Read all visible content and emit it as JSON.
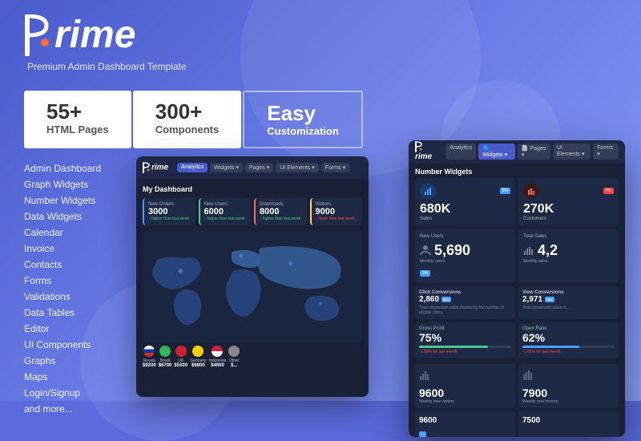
{
  "brand": {
    "name": "Prime",
    "p_letter": "P",
    "rest": "rime",
    "subtitle": "Premium Admin Dashboard Template"
  },
  "stats": [
    {
      "number": "55+",
      "label": "HTML Pages"
    },
    {
      "number": "300+",
      "label": "Components"
    },
    {
      "number": "Easy",
      "label": "Customization"
    }
  ],
  "nav": {
    "items": [
      "Admin Dashboard",
      "Graph Widgets",
      "Number Widgets",
      "Data Widgets",
      "Calendar",
      "Invoice",
      "Contacts",
      "Forms",
      "Validations",
      "Data Tables",
      "Editor",
      "UI Components",
      "Graphs",
      "Maps",
      "Login/Signup",
      "and more..."
    ]
  },
  "dashboard_left": {
    "title": "My Dashboard",
    "topnav": [
      "Analytics",
      "Widgets",
      "Pages",
      "UI Elements",
      "Forms"
    ],
    "stats": [
      {
        "label": "New Orders",
        "value": "3000",
        "sub": "higher than last week"
      },
      {
        "label": "New Users",
        "value": "6000",
        "sub": "higher than last week"
      },
      {
        "label": "Downloads",
        "value": "8000",
        "sub": "higher than last week"
      },
      {
        "label": "Visitors",
        "value": "9000",
        "sub": "lower than last week"
      }
    ],
    "flags": [
      {
        "country": "Russia",
        "value": "$9200",
        "color": "#4a9eff"
      },
      {
        "country": "Brazil",
        "value": "$6700",
        "color": "#2db85a"
      },
      {
        "country": "UK",
        "value": "$5300",
        "color": "#cc2233"
      },
      {
        "country": "Germany",
        "value": "$6800",
        "color": "#ffcc00"
      },
      {
        "country": "Indonesia",
        "value": "$4900",
        "color": "#cc2233"
      }
    ]
  },
  "dashboard_right": {
    "section_title": "Number Widgets",
    "topnav": [
      "Analytics",
      "Widgets",
      "Pages",
      "UI Elements",
      "Forms"
    ],
    "top_widgets": [
      {
        "value": "680K",
        "label": "Sales",
        "badge": "8%",
        "badge_color": "blue",
        "icon_color": "#4a9eff"
      },
      {
        "value": "270K",
        "label": "Customers",
        "badge": "4%",
        "badge_color": "red",
        "icon_color": "#ff6b6b"
      }
    ],
    "new_users": {
      "title": "New Users",
      "value": "5,690",
      "sub": "Monthly users",
      "badge": "0%"
    },
    "total_sales": {
      "title": "Total Sales",
      "value": "4,2",
      "sub": "Monthly sales"
    },
    "conversions": [
      {
        "title": "Click Conversions",
        "value": "2,860",
        "badge": "26%",
        "desc": "Total conversion value divided by the number of eligible clicks."
      },
      {
        "title": "View Conversions",
        "value": "2,971",
        "badge": "95%",
        "desc": "Total conversion value d..."
      }
    ],
    "progress": [
      {
        "label": "Gross Profit",
        "value": "75%",
        "fill": 75,
        "sub": "-1.69% for last month",
        "sub_color": "red"
      },
      {
        "label": "Open Ratio",
        "value": "62%",
        "fill": 62,
        "sub": "-1.65% for last month",
        "sub_color": "red"
      }
    ],
    "bottom": [
      {
        "value": "9600",
        "label": "Weekly new visitors"
      },
      {
        "value": "7900",
        "label": "Weekly new income"
      }
    ],
    "bottom2": [
      {
        "value": "9600",
        "label": ""
      },
      {
        "value": "7500",
        "label": ""
      }
    ]
  },
  "colors": {
    "bg_blue": "#5b6bde",
    "dark_bg": "#1a2035",
    "card_bg": "#1e2a45",
    "accent_blue": "#4a9eff",
    "accent_green": "#4ac88a",
    "accent_red": "#ff4444",
    "accent_yellow": "#ffd166"
  }
}
